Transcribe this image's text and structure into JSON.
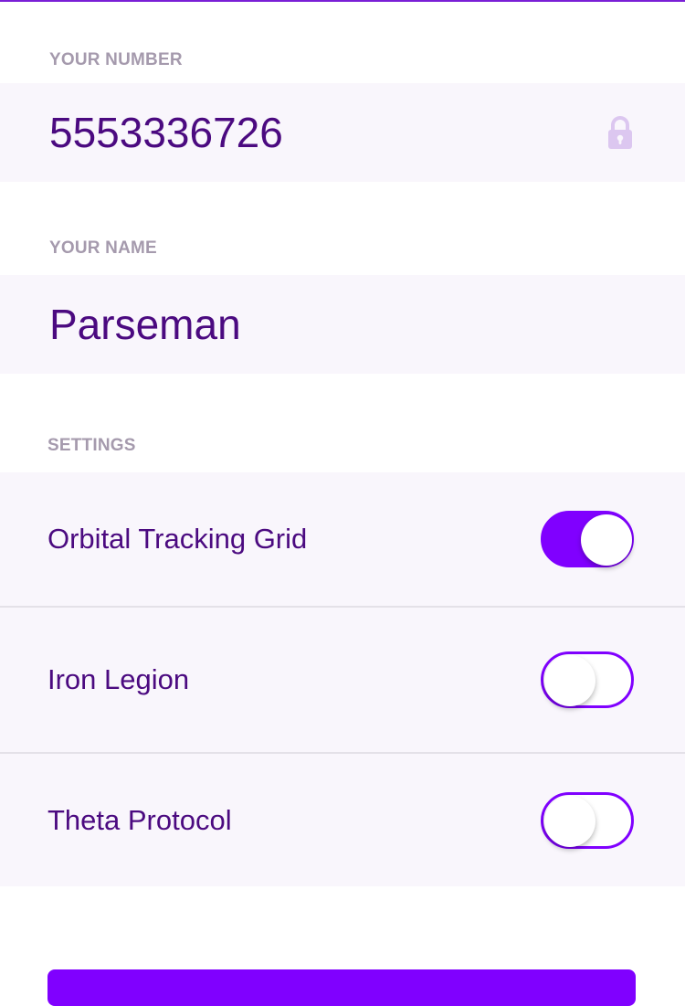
{
  "number_section": {
    "label": "YOUR NUMBER",
    "value": "5553336726",
    "locked_icon": "lock-icon"
  },
  "name_section": {
    "label": "YOUR NAME",
    "value": "Parseman"
  },
  "settings": {
    "label": "SETTINGS",
    "items": [
      {
        "label": "Orbital Tracking Grid",
        "enabled": true
      },
      {
        "label": "Iron Legion",
        "enabled": false
      },
      {
        "label": "Theta Protocol",
        "enabled": false
      }
    ]
  },
  "colors": {
    "accent": "#8000ff",
    "text": "#4b0a80",
    "section_label": "#a59aad",
    "row_background": "#f9f6fc"
  }
}
